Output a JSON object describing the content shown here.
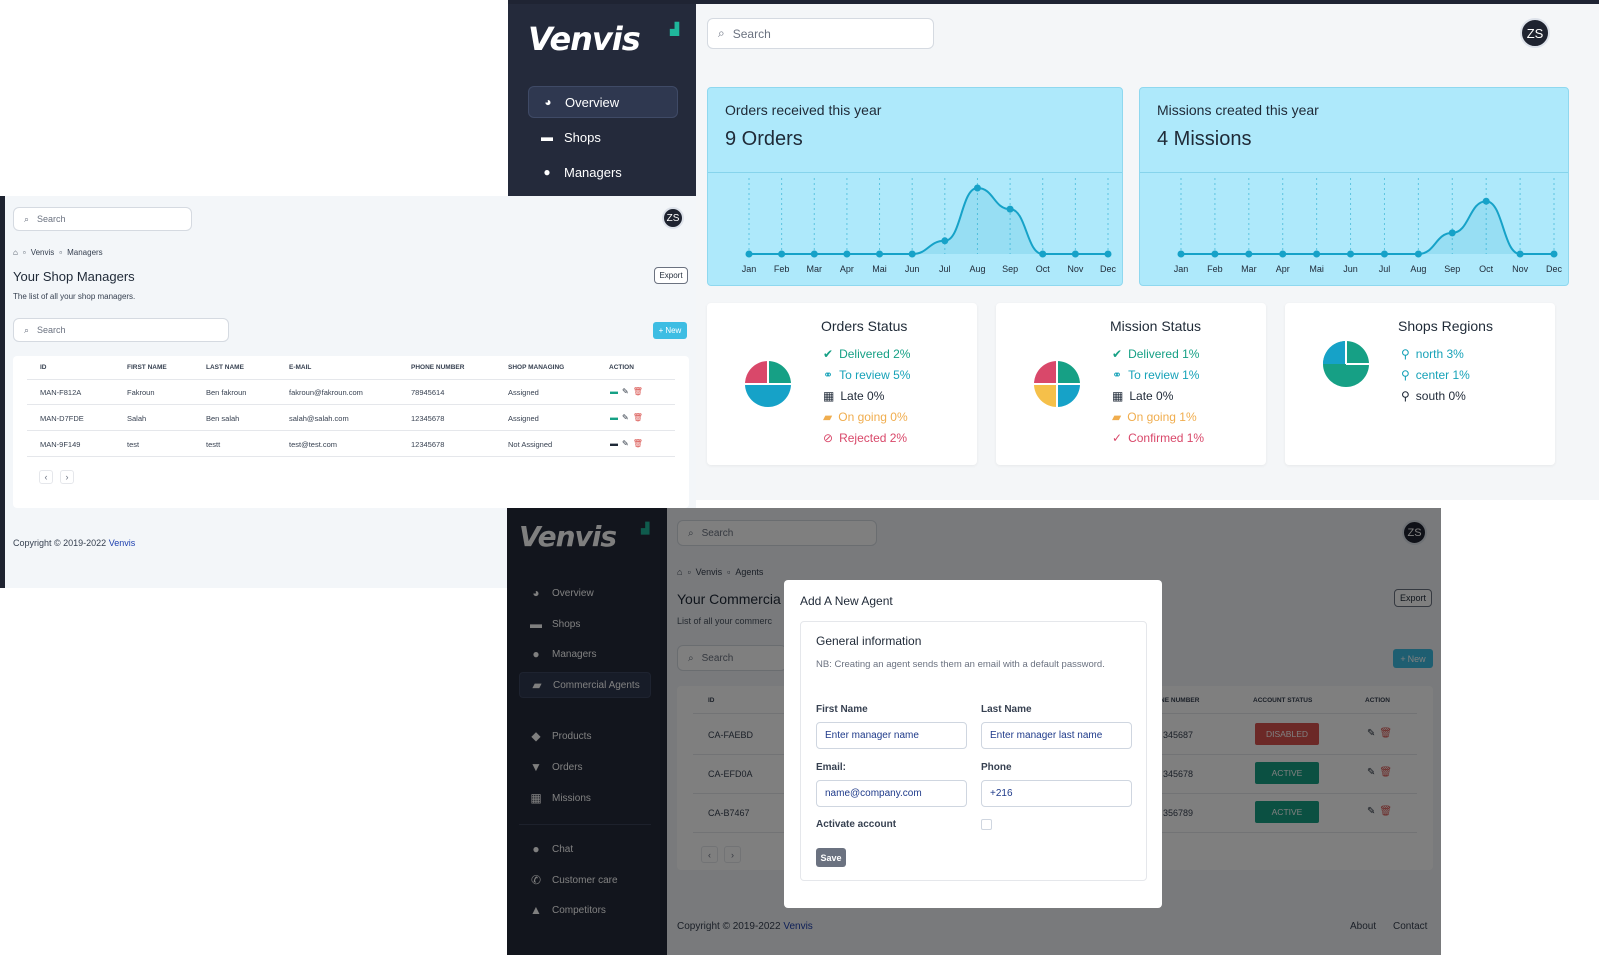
{
  "dashboard": {
    "logo": {
      "text": "Venvis"
    },
    "sidebar": [
      {
        "label": "Overview",
        "icon": "pie-chart-icon",
        "active": true
      },
      {
        "label": "Shops",
        "icon": "store-icon"
      },
      {
        "label": "Managers",
        "icon": "user-icon"
      }
    ],
    "search_placeholder": "Search",
    "avatar": "ZS",
    "orders_card": {
      "title": "Orders received this year",
      "value": "9 Orders"
    },
    "missions_card": {
      "title": "Missions created this year",
      "value": "4 Missions"
    },
    "orders_status": {
      "title": "Orders Status",
      "items": [
        {
          "label": "Delivered 2%",
          "icon": "check-circle-icon"
        },
        {
          "label": "To review 5%",
          "icon": "glasses-icon"
        },
        {
          "label": "Late 0%",
          "icon": "calendar-icon"
        },
        {
          "label": "On going 0%",
          "icon": "truck-icon"
        },
        {
          "label": "Rejected 2%",
          "icon": "ban-icon"
        }
      ]
    },
    "mission_status": {
      "title": "Mission Status",
      "items": [
        {
          "label": "Delivered 1%",
          "icon": "check-circle-icon"
        },
        {
          "label": "To review 1%",
          "icon": "glasses-icon"
        },
        {
          "label": "Late 0%",
          "icon": "calendar-icon"
        },
        {
          "label": "On going 1%",
          "icon": "truck-icon"
        },
        {
          "label": "Confirmed 1%",
          "icon": "check-icon"
        }
      ]
    },
    "shops_regions": {
      "title": "Shops Regions",
      "items": [
        {
          "label": "north 3%",
          "icon": "map-pin-icon"
        },
        {
          "label": "center 1%",
          "icon": "map-pin-icon"
        },
        {
          "label": "south 0%",
          "icon": "map-pin-icon"
        }
      ]
    },
    "colors": {
      "accent": "#16a2c8",
      "green": "#16a085",
      "orange": "#f0ad4e",
      "red": "#d9534f",
      "pink": "#d9486a",
      "yellow": "#f5c04a"
    }
  },
  "chart_data": [
    {
      "type": "line",
      "categories": [
        "Jan",
        "Feb",
        "Mar",
        "Apr",
        "Mai",
        "Jun",
        "Jul",
        "Aug",
        "Sep",
        "Oct",
        "Nov",
        "Dec"
      ],
      "values": [
        0,
        0,
        0,
        0,
        0,
        0,
        1,
        5,
        3.4,
        0,
        0,
        0
      ]
    },
    {
      "type": "line",
      "categories": [
        "Jan",
        "Feb",
        "Mar",
        "Apr",
        "Mai",
        "Jun",
        "Jul",
        "Aug",
        "Sep",
        "Oct",
        "Nov",
        "Dec"
      ],
      "values": [
        0,
        0,
        0,
        0,
        0,
        0,
        0,
        0,
        1.6,
        4,
        0,
        0
      ]
    }
  ],
  "managers": {
    "search_placeholder": "Search",
    "avatar": "ZS",
    "breadcrumb": [
      "Venvis",
      "Managers"
    ],
    "title": "Your Shop Managers",
    "subtitle": "The list of all your shop managers.",
    "export": "Export",
    "table_search": "Search",
    "new": "New",
    "columns": [
      "ID",
      "First Name",
      "Last Name",
      "E-mail",
      "Phone Number",
      "Shop Managing",
      "Action"
    ],
    "rows": [
      [
        "MAN-F812A",
        "Fakroun",
        "Ben fakroun",
        "fakroun@fakroun.com",
        "78945614",
        "Assigned"
      ],
      [
        "MAN-D7FDE",
        "Salah",
        "Ben salah",
        "salah@salah.com",
        "12345678",
        "Assigned"
      ],
      [
        "MAN-9F149",
        "test",
        "testt",
        "test@test.com",
        "12345678",
        "Not Assigned"
      ]
    ],
    "footer": "Copyright © 2019-2022 ",
    "footer_link": "Venvis"
  },
  "agents": {
    "logo": {
      "text": "Venvis"
    },
    "search_placeholder": "Search",
    "avatar": "ZS",
    "breadcrumb": [
      "Venvis",
      "Agents"
    ],
    "title": "Your Commercia",
    "subtitle": "List of all your commerc",
    "export": "Export",
    "table_search": "Search",
    "new": "New",
    "sidebar": [
      {
        "label": "Overview",
        "icon": "pie-chart-icon"
      },
      {
        "label": "Shops",
        "icon": "store-icon"
      },
      {
        "label": "Managers",
        "icon": "user-icon"
      },
      {
        "label": "Commercial Agents",
        "icon": "truck-icon",
        "active": true
      },
      {
        "label": "Products",
        "icon": "tags-icon"
      },
      {
        "label": "Orders",
        "icon": "basket-icon"
      },
      {
        "label": "Missions",
        "icon": "calendar-icon"
      },
      {
        "label": "Chat",
        "icon": "users-icon"
      },
      {
        "label": "Customer care",
        "icon": "phone-icon"
      },
      {
        "label": "Competitors",
        "icon": "user-secret-icon"
      }
    ],
    "columns": [
      "ID",
      "one number",
      "Account Status",
      "Action"
    ],
    "rows": [
      [
        "CA-FAEBD",
        "345687",
        "Disabled"
      ],
      [
        "CA-EFD0A",
        "345678",
        "Active"
      ],
      [
        "CA-B7467",
        "356789",
        "Active"
      ]
    ],
    "footer": "Copyright © 2019-2022 ",
    "footer_link": "Venvis",
    "footer_links": [
      "About",
      "Contact"
    ],
    "modal": {
      "title": "Add A New Agent",
      "section": "General information",
      "note": "NB: Creating an agent sends them an email with a default password.",
      "first_name_label": "First Name",
      "first_name_placeholder": "Enter manager name",
      "last_name_label": "Last Name",
      "last_name_placeholder": "Enter manager last name",
      "email_label": "Email:",
      "email_placeholder": "name@company.com",
      "phone_label": "Phone",
      "phone_value": "+216",
      "activate_label": "Activate account",
      "save": "Save"
    }
  }
}
